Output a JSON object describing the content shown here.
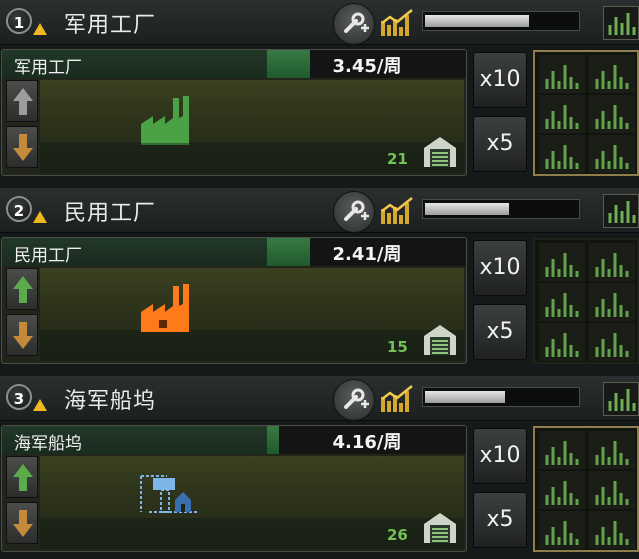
{
  "panels": [
    {
      "number": "1",
      "title": "军用工厂",
      "line_label": "军用工厂",
      "output": "3.45/周",
      "factory_count": "21",
      "factory_type": "military-factory-icon",
      "factory_color": "#4aa146",
      "production_progress": 0.68,
      "line_efficiency": 0.0,
      "up_arrow_active": false,
      "templates_selected": true
    },
    {
      "number": "2",
      "title": "民用工厂",
      "line_label": "民用工厂",
      "output": "2.41/周",
      "factory_count": "15",
      "factory_type": "civilian-factory-icon",
      "factory_color": "#ff7a18",
      "production_progress": 0.55,
      "line_efficiency": 0.0,
      "up_arrow_active": true,
      "templates_selected": false
    },
    {
      "number": "3",
      "title": "海军船坞",
      "line_label": "海军船坞",
      "output": "4.16/周",
      "factory_count": "26",
      "factory_type": "naval-dockyard-icon",
      "factory_color": "#7fb4e8",
      "production_progress": 0.52,
      "line_efficiency": 0.0,
      "up_arrow_active": true,
      "templates_selected": true
    }
  ],
  "buttons": {
    "x10": "x10",
    "x5": "x5"
  },
  "colors": {
    "accent_gold": "#d4a82c",
    "count_green": "#74c056",
    "warning_yellow": "#f0b820"
  }
}
